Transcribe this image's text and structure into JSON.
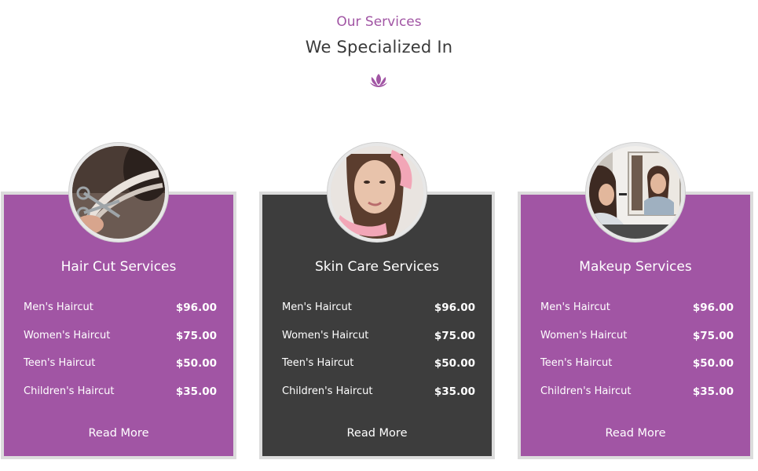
{
  "section": {
    "eyebrow": "Our Services",
    "heading": "We Specialized In",
    "divider_icon": "lotus-icon"
  },
  "colors": {
    "accent": "#a155a4",
    "dark_card": "#3d3d3d",
    "card_border": "#dcdcdc"
  },
  "cards": [
    {
      "title": "Hair Cut Services",
      "image": "hair-cutting-photo",
      "theme": "purple",
      "items": [
        {
          "name": "Men's Haircut",
          "price": "$96.00"
        },
        {
          "name": "Women's Haircut",
          "price": "$75.00"
        },
        {
          "name": "Teen's Haircut",
          "price": "$50.00"
        },
        {
          "name": "Children's Haircut",
          "price": "$35.00"
        }
      ],
      "cta": "Read More"
    },
    {
      "title": "Skin Care Services",
      "image": "skin-care-photo",
      "theme": "dark",
      "items": [
        {
          "name": "Men's Haircut",
          "price": "$96.00"
        },
        {
          "name": "Women's Haircut",
          "price": "$75.00"
        },
        {
          "name": "Teen's Haircut",
          "price": "$50.00"
        },
        {
          "name": "Children's Haircut",
          "price": "$35.00"
        }
      ],
      "cta": "Read More"
    },
    {
      "title": "Makeup Services",
      "image": "makeup-mirror-photo",
      "theme": "purple",
      "items": [
        {
          "name": "Men's Haircut",
          "price": "$96.00"
        },
        {
          "name": "Women's Haircut",
          "price": "$75.00"
        },
        {
          "name": "Teen's Haircut",
          "price": "$50.00"
        },
        {
          "name": "Children's Haircut",
          "price": "$35.00"
        }
      ],
      "cta": "Read More"
    }
  ]
}
